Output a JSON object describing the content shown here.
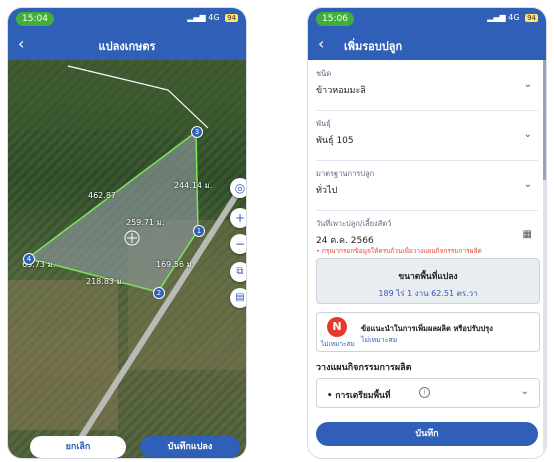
{
  "left": {
    "status": {
      "time": "15:04",
      "signal": "4G",
      "battery": "94"
    },
    "title": "แปลงเกษตร",
    "measurements": {
      "m1": "244.14 ม.",
      "m2": "462.87",
      "m3": "259.71 ม.",
      "m4": "169.56 ม.",
      "m5": "218.83 ม.",
      "m6": "63.73 ม."
    },
    "vertices": [
      "3",
      "1",
      "2",
      "4"
    ],
    "cancel_label": "ยกเลิก",
    "save_label": "บันทึกแปลง"
  },
  "right": {
    "status": {
      "time": "15:06",
      "signal": "4G",
      "battery": "94"
    },
    "title": "เพิ่มรอบปลูก",
    "fields": [
      {
        "label": "ชนิด",
        "value": "ข้าวหอมมะลิ"
      },
      {
        "label": "พันธุ์",
        "value": "พันธุ์ 105"
      },
      {
        "label": "มาตรฐานการปลูก",
        "value": "ทั่วไป"
      },
      {
        "label": "วันที่เพาะปลูก/เลี้ยงสัตว์",
        "value": "24 ต.ค. 2566"
      }
    ],
    "warning": "• กรุณากรอกข้อมูลให้ครบถ้วนเพื่อวางแผนกิจกรรมการผลิต",
    "area": {
      "title": "ขนาดพื้นที่แปลง",
      "value": "189 ไร่ 1 งาน 62.51 ตร.วา"
    },
    "advice": {
      "badge": "N",
      "badge_caption": "ไม่เหมาะสม",
      "title": "ข้อแนะนำในการเพิ่มผลผลิต หรือปรับปรุง",
      "sub": "ไม่เหมาะสม"
    },
    "plan_heading": "วางแผนกิจกรรมการผลิต",
    "plan_item": "• การเตรียมพื้นที่",
    "save_label": "บันทึก"
  }
}
